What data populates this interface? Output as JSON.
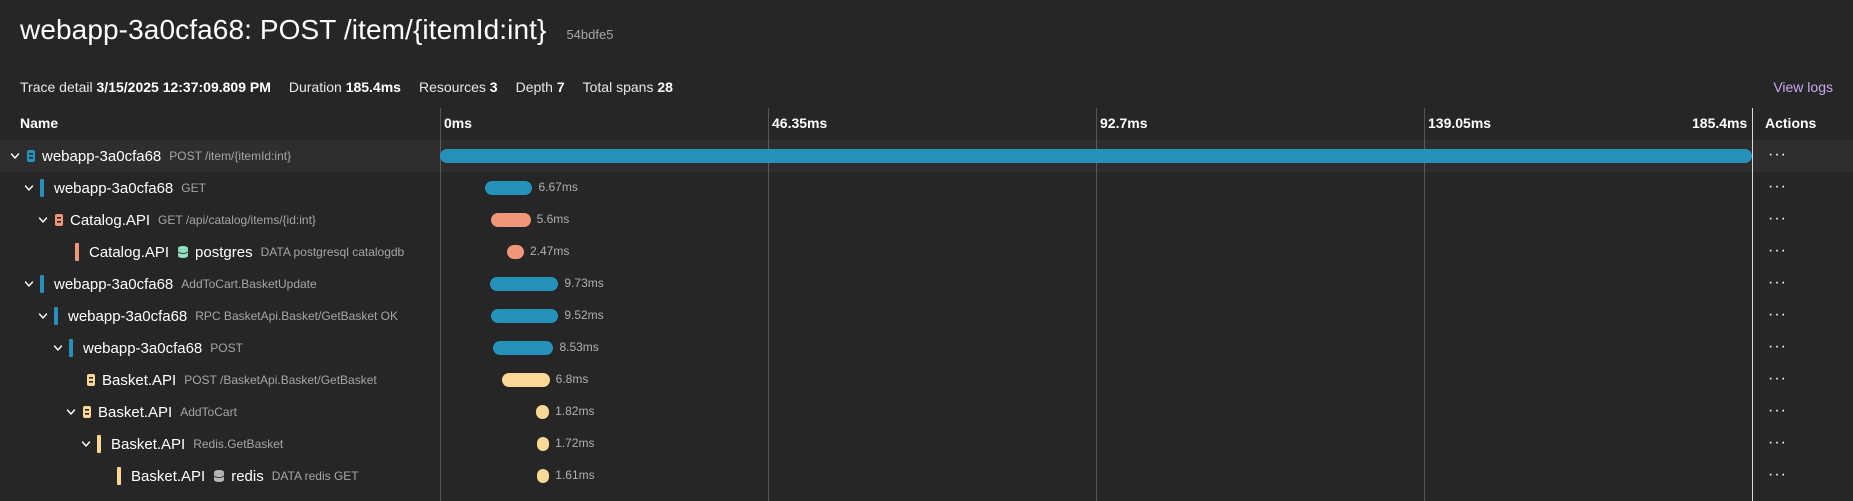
{
  "header": {
    "title": "webapp-3a0cfa68: POST /item/{itemId:int}",
    "trace_id": "54bdfe5"
  },
  "meta": {
    "trace_detail_label": "Trace detail",
    "trace_detail_value": "3/15/2025 12:37:09.809 PM",
    "duration_label": "Duration",
    "duration_value": "185.4ms",
    "resources_label": "Resources",
    "resources_value": "3",
    "depth_label": "Depth",
    "depth_value": "7",
    "spans_label": "Total spans",
    "spans_value": "28",
    "view_logs": "View logs"
  },
  "columns": {
    "name": "Name",
    "actions": "Actions",
    "ticks": [
      "0ms",
      "46.35ms",
      "92.7ms",
      "139.05ms",
      "185.4ms"
    ]
  },
  "colors": {
    "webapp": "#2592bb",
    "catalog": "#f19779",
    "catalog_db": "#f49a80",
    "basket": "#fbd896",
    "db_icon_green": "#8fe1c1",
    "db_icon_gray": "#b5b5b5"
  },
  "spans": [
    {
      "service": "webapp-3a0cfa68",
      "operation": "POST /item/{itemId:int}",
      "duration": "",
      "expanded": true,
      "kind": "server",
      "color": "#2592bb",
      "start_ms": 0,
      "dur_ms": 185.4
    },
    {
      "service": "webapp-3a0cfa68",
      "operation": "GET",
      "duration": "6.67ms",
      "expanded": true,
      "kind": "bar",
      "color": "#2592bb",
      "start_ms": 6.4,
      "dur_ms": 6.67
    },
    {
      "service": "Catalog.API",
      "operation": "GET /api/catalog/items/{id:int}",
      "duration": "5.6ms",
      "expanded": true,
      "kind": "server",
      "color": "#f19779",
      "start_ms": 7.2,
      "dur_ms": 5.6
    },
    {
      "service": "Catalog.API",
      "peer": "postgres",
      "operation": "DATA postgresql catalogdb",
      "duration": "2.47ms",
      "expanded": false,
      "kind": "db",
      "color": "#f19779",
      "start_ms": 9.4,
      "dur_ms": 2.47
    },
    {
      "service": "webapp-3a0cfa68",
      "operation": "AddToCart.BasketUpdate",
      "duration": "9.73ms",
      "expanded": true,
      "kind": "bar",
      "color": "#2592bb",
      "start_ms": 7.0,
      "dur_ms": 9.73
    },
    {
      "service": "webapp-3a0cfa68",
      "operation": "RPC BasketApi.Basket/GetBasket OK",
      "duration": "9.52ms",
      "expanded": true,
      "kind": "bar",
      "color": "#2592bb",
      "start_ms": 7.2,
      "dur_ms": 9.52
    },
    {
      "service": "webapp-3a0cfa68",
      "operation": "POST",
      "duration": "8.53ms",
      "expanded": true,
      "kind": "bar",
      "color": "#2592bb",
      "start_ms": 7.5,
      "dur_ms": 8.53
    },
    {
      "service": "Basket.API",
      "operation": "POST /BasketApi.Basket/GetBasket",
      "duration": "6.8ms",
      "expanded": false,
      "kind": "server",
      "color": "#fbd896",
      "start_ms": 8.7,
      "dur_ms": 6.8
    },
    {
      "service": "Basket.API",
      "operation": "AddToCart",
      "duration": "1.82ms",
      "expanded": true,
      "kind": "server",
      "color": "#fbd896",
      "start_ms": 13.6,
      "dur_ms": 1.82
    },
    {
      "service": "Basket.API",
      "operation": "Redis.GetBasket",
      "duration": "1.72ms",
      "expanded": true,
      "kind": "bar",
      "color": "#fbd896",
      "start_ms": 13.7,
      "dur_ms": 1.72
    },
    {
      "service": "Basket.API",
      "peer": "redis",
      "operation": "DATA redis GET",
      "duration": "1.61ms",
      "expanded": false,
      "kind": "db",
      "color": "#fbd896",
      "start_ms": 13.75,
      "dur_ms": 1.61
    }
  ]
}
